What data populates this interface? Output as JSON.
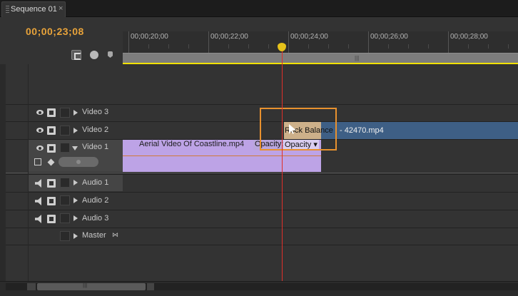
{
  "tab": {
    "title": "Sequence 01",
    "close": "×"
  },
  "timecode": "00;00;23;08",
  "ruler": {
    "labels": [
      "00;00;20;00",
      "00;00;22;00",
      "00;00;24;00",
      "00;00;26;00",
      "00;00;28;00"
    ],
    "work_area_grip": "|||"
  },
  "tools": [
    "snap-icon",
    "add-marker-icon",
    "flag-icon"
  ],
  "tracks": {
    "video": [
      {
        "name": "Video 3"
      },
      {
        "name": "Video 2"
      },
      {
        "name": "Video 1"
      }
    ],
    "audio": [
      {
        "name": "Audio 1"
      },
      {
        "name": "Audio 2"
      },
      {
        "name": "Audio 3"
      }
    ],
    "master": {
      "name": "Master"
    }
  },
  "clips": {
    "video1": {
      "title": "Aerial Video Of Coastline.mp4",
      "opacity_a": "Opacity:",
      "opacity_b": "Opacity ▾"
    },
    "video2": {
      "title_part1": "Rock Balance",
      "title_part2": "- 42470.mp4"
    }
  },
  "colors": {
    "timecode": "#e8a33a",
    "playhead": "#e0302a",
    "work_area": "#f2e200",
    "video1_clip": "#bda3e6",
    "video2_clip": "#3e5f85",
    "drag_rect": "#e8912e"
  },
  "scrollbar": {
    "grip": "|||"
  }
}
